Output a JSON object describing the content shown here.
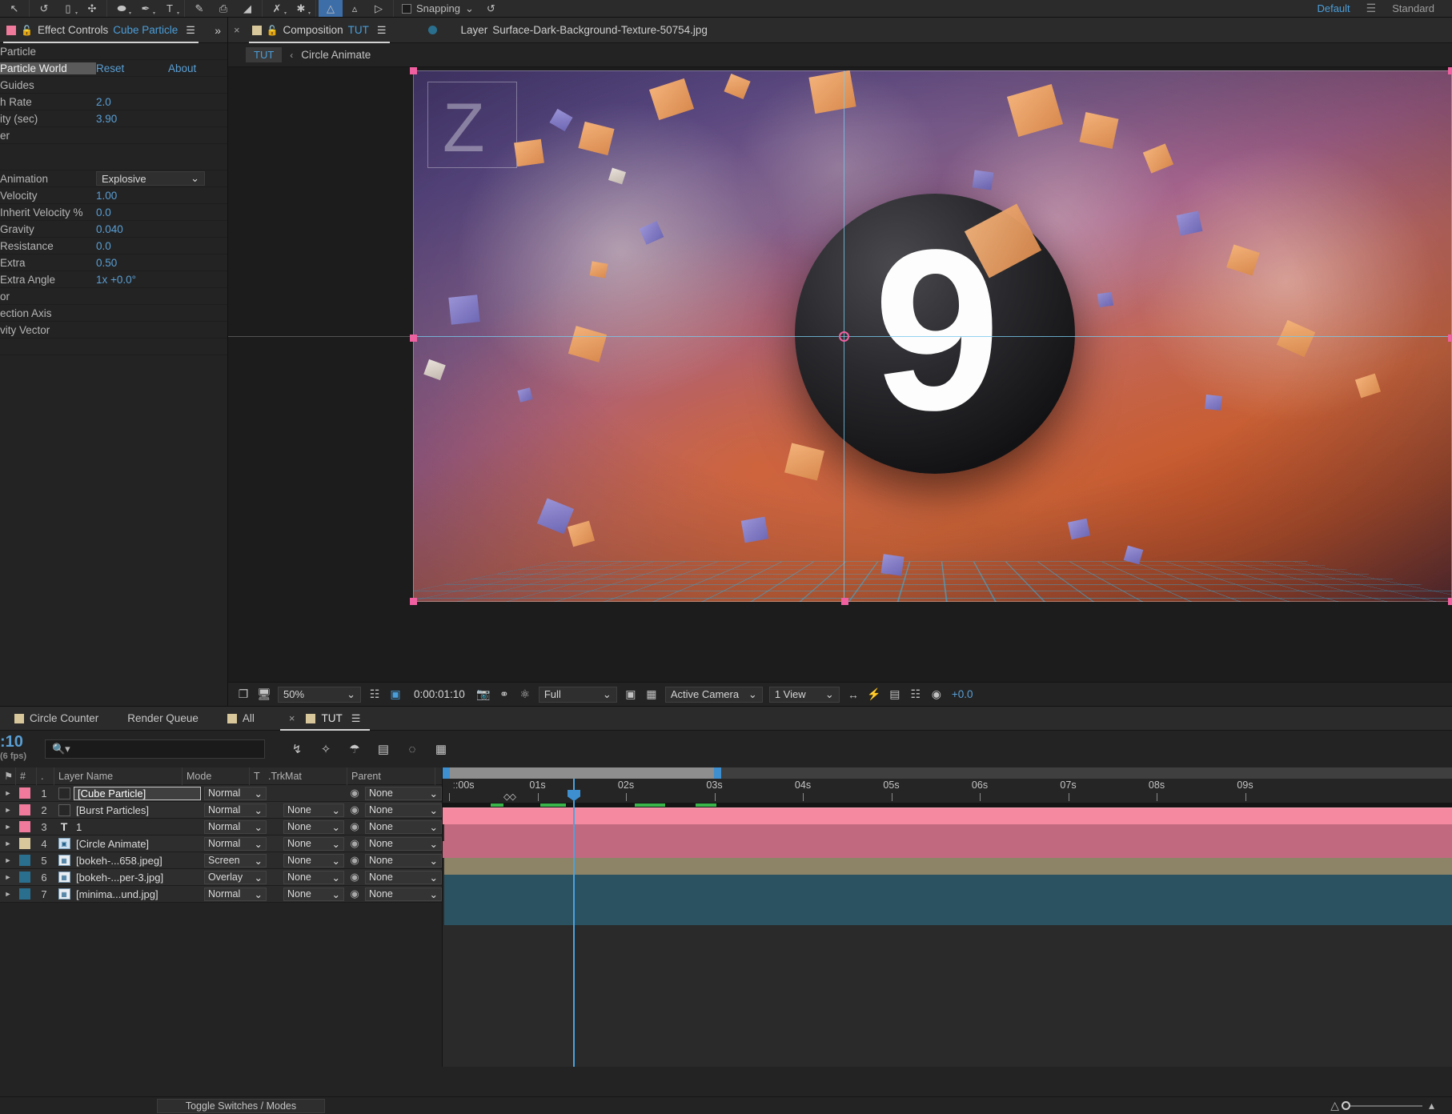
{
  "toolbar": {
    "snapping_label": "Snapping",
    "workspaces": [
      {
        "label": "Default",
        "active": true
      },
      {
        "label": "Standard",
        "active": false
      }
    ],
    "tools": [
      {
        "name": "selection-tool",
        "glyph": "↖"
      },
      {
        "name": "rotation-tool",
        "glyph": "↺"
      },
      {
        "name": "camera-tool",
        "glyph": "▭"
      },
      {
        "name": "anchor-point-tool",
        "glyph": "✣"
      },
      {
        "name": "shape-tool",
        "glyph": "⬬"
      },
      {
        "name": "pen-tool",
        "glyph": "✒"
      },
      {
        "name": "type-tool",
        "glyph": "T"
      },
      {
        "name": "brush-tool",
        "glyph": "✎"
      },
      {
        "name": "clone-stamp-tool",
        "glyph": "⎙"
      },
      {
        "name": "eraser-tool",
        "glyph": "◢"
      },
      {
        "name": "roto-brush-tool",
        "glyph": "✇"
      },
      {
        "name": "puppet-pin-tool",
        "glyph": "✕"
      }
    ]
  },
  "effect_controls": {
    "panel_title": "Effect Controls",
    "panel_subject": "Cube Particle",
    "layer_group": "Particle",
    "effect_name": "Particle World",
    "reset_label": "Reset",
    "about_label": "About",
    "rows": [
      {
        "name": "Guides",
        "value": ""
      },
      {
        "name": "h Rate",
        "value": "2.0"
      },
      {
        "name": "ity (sec)",
        "value": "3.90"
      },
      {
        "name": "er",
        "value": ""
      }
    ],
    "physics_rows": [
      {
        "name": "Animation",
        "value": "Explosive",
        "type": "select"
      },
      {
        "name": "Velocity",
        "value": "1.00",
        "type": "number"
      },
      {
        "name": "Inherit Velocity %",
        "value": "0.0",
        "type": "number"
      },
      {
        "name": "Gravity",
        "value": "0.040",
        "type": "number"
      },
      {
        "name": "Resistance",
        "value": "0.0",
        "type": "number"
      },
      {
        "name": "Extra",
        "value": "0.50",
        "type": "number"
      },
      {
        "name": "Extra Angle",
        "value": "1x +0.0°",
        "type": "number"
      }
    ],
    "tail_rows": [
      {
        "name": "or",
        "value": ""
      },
      {
        "name": "ection Axis",
        "value": ""
      },
      {
        "name": "vity Vector",
        "value": ""
      }
    ]
  },
  "composition": {
    "tab_label": "Composition",
    "tab_name": "TUT",
    "close_glyph": "×",
    "layer_tab_label": "Layer",
    "layer_tab_name": "Surface-Dark-Background-Texture-50754.jpg",
    "breadcrumb": {
      "root": "TUT",
      "arrow": "‹",
      "current": "Circle Animate"
    },
    "canvas": {
      "digit": "9",
      "watermark": "Z"
    },
    "viewer_toolbar": {
      "zoom": "50%",
      "timecode": "0:00:01:10",
      "resolution": "Full",
      "camera": "Active Camera",
      "views": "1 View",
      "exposure": "+0.0"
    }
  },
  "timeline": {
    "tabs": [
      {
        "label": "Circle Counter",
        "active": false,
        "has_square": true
      },
      {
        "label": "Render Queue",
        "active": false,
        "has_square": false
      },
      {
        "label": "All",
        "active": false,
        "has_square": true
      },
      {
        "label": "TUT",
        "active": true,
        "has_square": true
      }
    ],
    "current_time": ":10",
    "fps_label": "(6 fps)",
    "search_placeholder": "",
    "columns": {
      "tag": "⚑",
      "num": "#",
      "name": "Layer Name",
      "mode": "Mode",
      "t": "T",
      "trkmat": ".TrkMat",
      "parent": "Parent"
    },
    "layers": [
      {
        "index": "1",
        "name": "[Cube Particle]",
        "mode": "Normal",
        "trkmat": "",
        "parent": "None",
        "color": "#ef7a9b",
        "icon": "box",
        "selected": true,
        "bar": "bar-pink",
        "bar_start": 0,
        "bar_end": 100
      },
      {
        "index": "2",
        "name": "[Burst Particles]",
        "mode": "Normal",
        "trkmat": "None",
        "parent": "None",
        "color": "#ef7a9b",
        "icon": "box",
        "selected": false,
        "bar": "bar-pink2",
        "bar_start": 2,
        "bar_end": 100
      },
      {
        "index": "3",
        "name": "1",
        "mode": "Normal",
        "trkmat": "None",
        "parent": "None",
        "color": "#ef7a9b",
        "icon": "text",
        "selected": false,
        "bar": "bar-pink2",
        "bar_start": 0,
        "bar_end": 100
      },
      {
        "index": "4",
        "name": "[Circle Animate]",
        "mode": "Normal",
        "trkmat": "None",
        "parent": "None",
        "color": "#d8c79a",
        "icon": "comp",
        "selected": false,
        "bar": "bar-tan",
        "bar_start": 2,
        "bar_end": 100
      },
      {
        "index": "5",
        "name": "[bokeh-...658.jpeg]",
        "mode": "Screen",
        "trkmat": "None",
        "parent": "None",
        "color": "#2a6f8e",
        "icon": "img",
        "selected": false,
        "bar": "bar-teal",
        "bar_start": 2,
        "bar_end": 100
      },
      {
        "index": "6",
        "name": "[bokeh-...per-3.jpg]",
        "mode": "Overlay",
        "trkmat": "None",
        "parent": "None",
        "color": "#2a6f8e",
        "icon": "img",
        "selected": false,
        "bar": "bar-teal",
        "bar_start": 2,
        "bar_end": 100
      },
      {
        "index": "7",
        "name": "[minima...und.jpg]",
        "mode": "Normal",
        "trkmat": "None",
        "parent": "None",
        "color": "#2a6f8e",
        "icon": "img",
        "selected": false,
        "bar": "bar-teal",
        "bar_start": 2,
        "bar_end": 100
      }
    ],
    "ruler_labels": [
      "ː:00s",
      "01s",
      "02s",
      "03s",
      "04s",
      "05s",
      "06s",
      "07s",
      "08s",
      "09s"
    ],
    "toggle_switches_label": "Toggle Switches / Modes"
  },
  "chart_data": null
}
